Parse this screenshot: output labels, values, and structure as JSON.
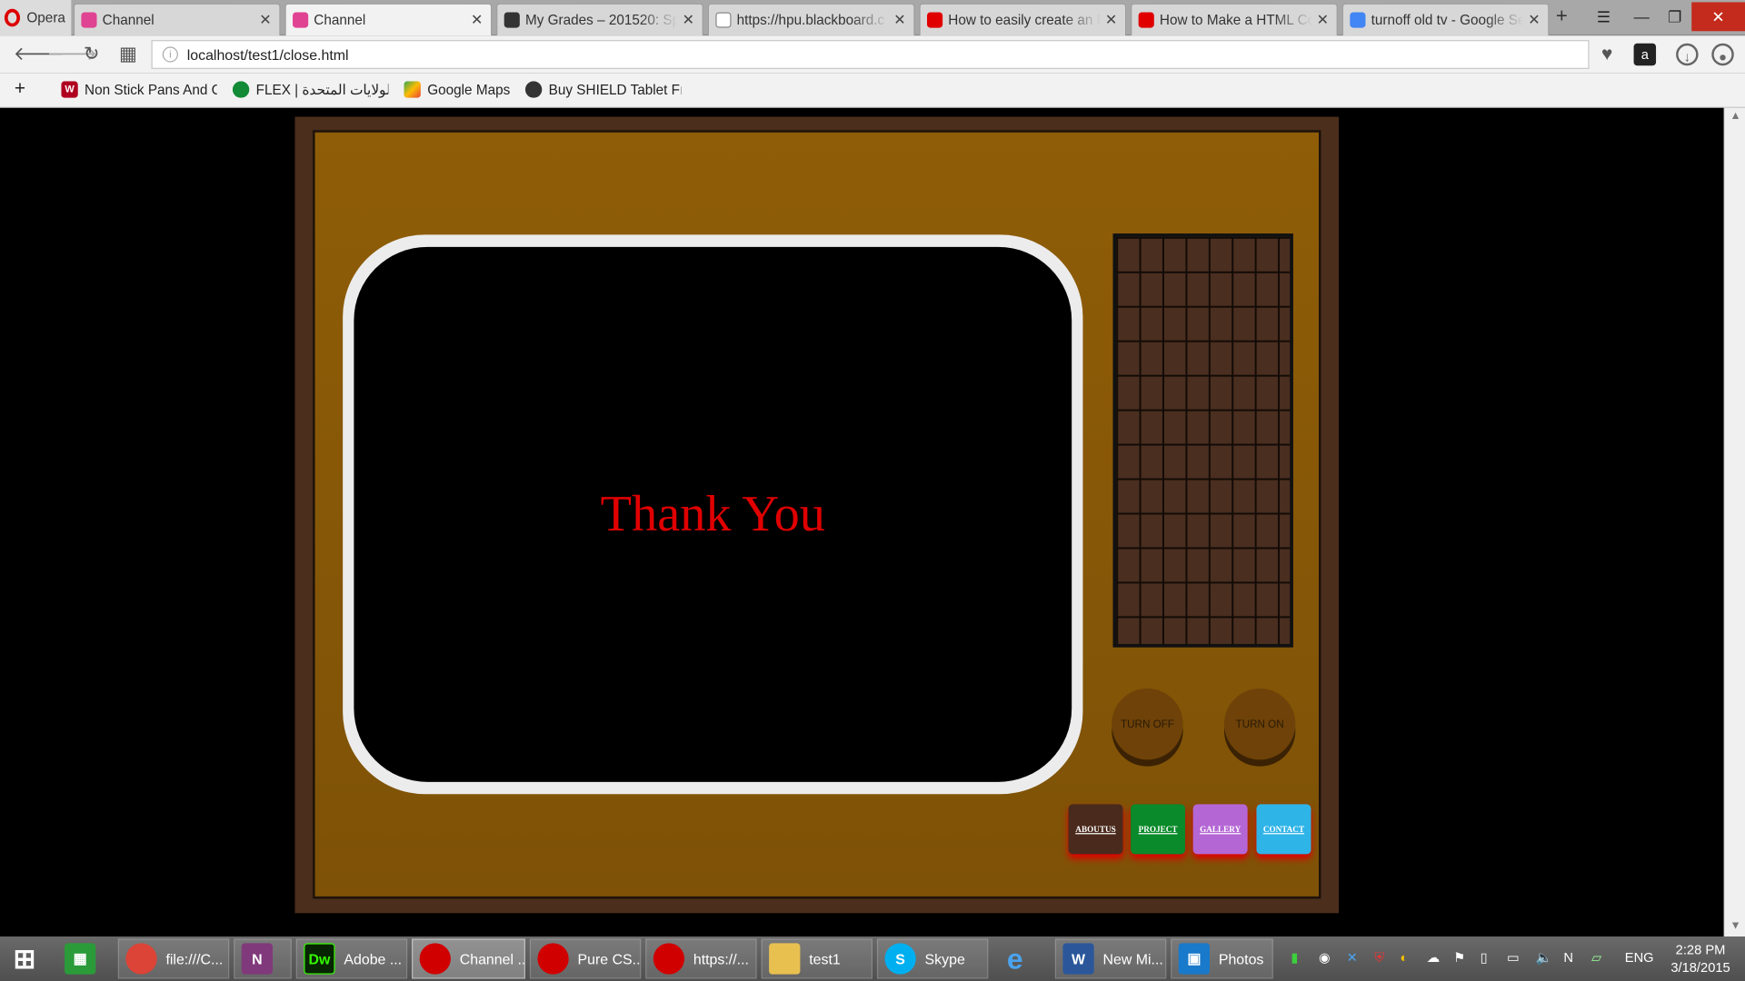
{
  "browser": {
    "menu_label": "Opera",
    "tabs": [
      {
        "title": "Channel",
        "icon": "channel-favicon",
        "color": "#e04391"
      },
      {
        "title": "Channel",
        "icon": "channel-favicon",
        "color": "#e04391",
        "active": true
      },
      {
        "title": "My Grades – 201520: Spr",
        "icon": "blackboard-favicon",
        "color": "#333333"
      },
      {
        "title": "https://hpu.blackboard.c",
        "icon": "page-favicon",
        "color": "#888888"
      },
      {
        "title": "How to easily create an E",
        "icon": "youtube-favicon",
        "color": "#e00000"
      },
      {
        "title": "How to Make a HTML Co",
        "icon": "youtube-favicon",
        "color": "#e00000"
      },
      {
        "title": "turnoff old tv - Google Se",
        "icon": "google-favicon",
        "color": "#4285f4"
      }
    ],
    "url": "localhost/test1/close.html",
    "bookmarks": [
      {
        "label": "Non Stick Pans And C",
        "icon": "wc-favicon"
      },
      {
        "label": "FLEX | الولايات المتحدة",
        "icon": "flex-favicon"
      },
      {
        "label": "Google Maps",
        "icon": "maps-favicon"
      },
      {
        "label": "Buy SHIELD Tablet Fr",
        "icon": "nvidia-favicon"
      }
    ]
  },
  "tv": {
    "screen_text": "Thank You",
    "knobs": {
      "off": "TURN OFF",
      "on": "TURN ON"
    },
    "buttons": [
      {
        "label": "ABOUTUS",
        "color": "#4a2a1c"
      },
      {
        "label": "PROJECT",
        "color": "#0a8a2a"
      },
      {
        "label": "GALLERY",
        "color": "#b467d4"
      },
      {
        "label": "CONTACT",
        "color": "#2fb4e8"
      }
    ]
  },
  "taskbar": {
    "items": [
      {
        "label": "file:///C...",
        "icon": "chrome-icon",
        "color": "#db4437"
      },
      {
        "label": "",
        "icon": "onenote-icon",
        "color": "#80397b"
      },
      {
        "label": "Adobe ...",
        "icon": "dreamweaver-icon",
        "color": "#35fa00"
      },
      {
        "label": "Channel ...",
        "icon": "opera-icon",
        "color": "#d00000"
      },
      {
        "label": "Pure CS...",
        "icon": "opera-icon",
        "color": "#d00000"
      },
      {
        "label": "https://...",
        "icon": "opera-icon",
        "color": "#d00000"
      },
      {
        "label": "test1",
        "icon": "folder-icon",
        "color": "#e8c050"
      },
      {
        "label": "Skype",
        "icon": "skype-icon",
        "color": "#00aff0"
      },
      {
        "label": "",
        "icon": "ie-icon",
        "color": "#1e88e5"
      },
      {
        "label": "New Mi...",
        "icon": "word-icon",
        "color": "#2b579a"
      },
      {
        "label": "Photos",
        "icon": "photos-icon",
        "color": "#1979ca"
      }
    ],
    "language": "ENG",
    "time": "2:28 PM",
    "date": "3/18/2015"
  }
}
